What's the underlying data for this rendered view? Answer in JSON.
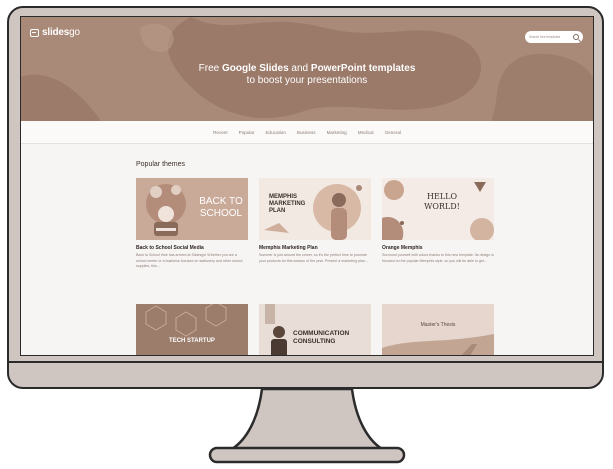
{
  "site": {
    "logo_text": "slides",
    "logo_suffix": "go",
    "search_placeholder": "Search free templates"
  },
  "hero": {
    "line1_pre": "Free ",
    "line1_bold1": "Google Slides",
    "line1_mid": " and ",
    "line1_bold2": "PowerPoint templates",
    "line2": "to boost your presentations"
  },
  "nav": [
    "Recent",
    "Popular",
    "Education",
    "Business",
    "Marketing",
    "Medical",
    "General"
  ],
  "section_title": "Popular themes",
  "cards": [
    {
      "title": "Back to School Social Media",
      "desc": "Back to School time has arrived at Slidesgo! Whether you are a school center or a business focused on stationery and other school supplies, this...",
      "thumb_text": [
        "BACK TO",
        "SCHOOL"
      ]
    },
    {
      "title": "Memphis Marketing Plan",
      "desc": "Summer is just around the corner, so it's the perfect time to promote your products for this season of the year. Present a marketing plan...",
      "thumb_text": [
        "MEMPHIS",
        "MARKETING",
        "PLAN"
      ]
    },
    {
      "title": "Orange Memphis",
      "desc": "Surround yourself with colors thanks to this new template. Its design is focused on the popular Memphis style, so you will be able to get...",
      "thumb_text": [
        "HELLO",
        "WORLD!"
      ]
    },
    {
      "thumb_text": [
        "TECH STARTUP"
      ]
    },
    {
      "thumb_text": [
        "COMMUNICATION",
        "CONSULTING"
      ]
    },
    {
      "thumb_text": [
        "Master's Thesis"
      ]
    }
  ],
  "colors": {
    "hero_bg": "#a98977",
    "hero_blob": "#8f6e5e",
    "bezel": "#cfc5c1",
    "outline": "#2b2b2b"
  }
}
